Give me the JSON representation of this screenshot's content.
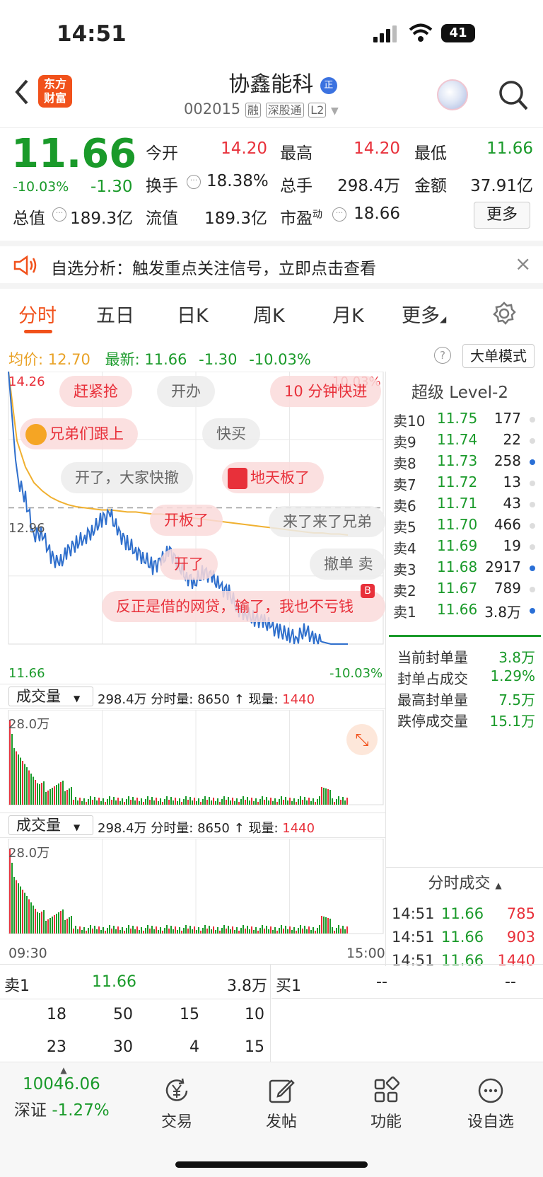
{
  "status": {
    "time": "14:51",
    "battery": "41"
  },
  "header": {
    "logo": [
      "东方",
      "财富"
    ],
    "stock_name": "协鑫能科",
    "badge": "正",
    "code": "002015",
    "tags": [
      "融",
      "深股通",
      "L2"
    ]
  },
  "quote": {
    "price": "11.66",
    "change_pct": "-10.03%",
    "change": "-1.30",
    "open_label": "今开",
    "open": "14.20",
    "high_label": "最高",
    "high": "14.20",
    "low_label": "最低",
    "low": "11.66",
    "turnover_label": "换手",
    "turnover": "18.38%",
    "volume_label": "总手",
    "volume": "298.4万",
    "amount_label": "金额",
    "amount": "37.91亿",
    "mktcap_label": "总值",
    "mktcap": "189.3亿",
    "float_label": "流值",
    "float": "189.3亿",
    "pe_label": "市盈",
    "pe_sup": "动",
    "pe": "18.66",
    "more_button": "更多"
  },
  "alert": {
    "text": "自选分析：触发重点关注信号，立即点击查看",
    "close": "×"
  },
  "tabs": [
    {
      "label": "分时",
      "active": true
    },
    {
      "label": "五日"
    },
    {
      "label": "日K"
    },
    {
      "label": "周K"
    },
    {
      "label": "月K"
    },
    {
      "label": "更多"
    }
  ],
  "chart_header": {
    "avg_label": "均价:",
    "avg": "12.70",
    "latest_label": "最新:",
    "latest": "11.66",
    "change": "-1.30",
    "change_pct": "-10.03%",
    "mode_button": "大单模式"
  },
  "chart_axis": {
    "top_price": "14.26",
    "top_pct": "10.03%",
    "mid_price": "12.96",
    "bottom_price": "11.66",
    "bottom_pct": "-10.03%"
  },
  "danmaku": [
    {
      "text": "赶紧抢",
      "style": "red"
    },
    {
      "text": "开办",
      "style": "gray"
    },
    {
      "text": "10 分钟快进",
      "style": "red"
    },
    {
      "text": "兄弟们跟上",
      "style": "red"
    },
    {
      "text": "快买",
      "style": "gray"
    },
    {
      "text": "开了，大家快撤",
      "style": "gray"
    },
    {
      "text": "地天板了",
      "style": "red"
    },
    {
      "text": "开板了",
      "style": "red"
    },
    {
      "text": "来了来了兄弟",
      "style": "gray"
    },
    {
      "text": "开了",
      "style": "red"
    },
    {
      "text": "撤单 卖",
      "style": "gray"
    },
    {
      "text": "反正是借的网贷，输了，我也不亏钱",
      "style": "red"
    }
  ],
  "volume_panels": [
    {
      "label": "成交量",
      "total": "298.4万",
      "minute_label": "分时量:",
      "minute": "8650",
      "now_label": "现量:",
      "now": "1440",
      "axis_max": "28.0万"
    },
    {
      "label": "成交量",
      "total": "298.4万",
      "minute_label": "分时量:",
      "minute": "8650",
      "now_label": "现量:",
      "now": "1440",
      "axis_max": "28.0万"
    }
  ],
  "time_axis": {
    "start": "09:30",
    "end": "15:00"
  },
  "orderbook": {
    "title": "超级 Level-2",
    "asks": [
      {
        "label": "卖10",
        "price": "11.75",
        "vol": "177"
      },
      {
        "label": "卖9",
        "price": "11.74",
        "vol": "22"
      },
      {
        "label": "卖8",
        "price": "11.73",
        "vol": "258"
      },
      {
        "label": "卖7",
        "price": "11.72",
        "vol": "13"
      },
      {
        "label": "卖6",
        "price": "11.71",
        "vol": "43"
      },
      {
        "label": "卖5",
        "price": "11.70",
        "vol": "466"
      },
      {
        "label": "卖4",
        "price": "11.69",
        "vol": "19"
      },
      {
        "label": "卖3",
        "price": "11.68",
        "vol": "2917"
      },
      {
        "label": "卖2",
        "price": "11.67",
        "vol": "789"
      },
      {
        "label": "卖1",
        "price": "11.66",
        "vol": "3.8万"
      }
    ],
    "stats": [
      {
        "label": "当前封单量",
        "value": "3.8万"
      },
      {
        "label": "封单占成交",
        "value": "1.29%"
      },
      {
        "label": "最高封单量",
        "value": "7.5万"
      },
      {
        "label": "跌停成交量",
        "value": "15.1万"
      }
    ],
    "ticks_title": "分时成交",
    "ticks": [
      {
        "time": "14:51",
        "price": "11.66",
        "vol": "785"
      },
      {
        "time": "14:51",
        "price": "11.66",
        "vol": "903"
      },
      {
        "time": "14:51",
        "price": "11.66",
        "vol": "1440"
      }
    ]
  },
  "bottom_table": {
    "sell_label": "卖1",
    "sell_price": "11.66",
    "sell_vol": "3.8万",
    "buy_label": "买1",
    "buy_price": "--",
    "buy_vol": "--",
    "rows": [
      [
        "18",
        "50",
        "15",
        "10"
      ],
      [
        "23",
        "30",
        "4",
        "15"
      ]
    ]
  },
  "footer": {
    "index_value": "10046.06",
    "index_name": "深证",
    "index_change": "-1.27%",
    "buttons": [
      {
        "label": "交易",
        "icon": "yen-cycle-icon"
      },
      {
        "label": "发帖",
        "icon": "edit-icon"
      },
      {
        "label": "功能",
        "icon": "grid-icon"
      },
      {
        "label": "设自选",
        "icon": "dots-circle-icon"
      }
    ]
  },
  "chart_data": {
    "type": "line",
    "title": "",
    "xlabel": "",
    "ylabel": "",
    "x_range": [
      "09:30",
      "15:00"
    ],
    "ylim": [
      11.66,
      14.26
    ],
    "series": [
      {
        "name": "最新",
        "color": "#2f6fcc",
        "values": [
          14.26,
          13.25,
          13.05,
          12.7,
          12.72,
          12.5,
          12.42,
          12.55,
          12.62,
          12.68,
          12.75,
          12.85,
          12.9,
          12.72,
          12.62,
          12.55,
          12.48,
          12.4,
          12.45,
          12.55,
          12.42,
          12.3,
          12.25,
          12.35,
          12.3,
          12.2,
          12.15,
          12.0,
          11.95,
          11.9,
          11.88,
          11.82,
          11.78,
          11.75,
          11.72,
          11.8,
          11.7,
          11.68,
          11.66,
          11.66,
          11.66
        ]
      },
      {
        "name": "均价",
        "color": "#f0b030",
        "values": [
          14.26,
          13.6,
          13.35,
          13.2,
          13.12,
          13.06,
          13.02,
          12.99,
          12.97,
          12.96,
          12.95,
          12.94,
          12.94,
          12.93,
          12.92,
          12.92,
          12.91,
          12.9,
          12.9,
          12.89,
          12.88,
          12.87,
          12.86,
          12.85,
          12.84,
          12.83,
          12.82,
          12.81,
          12.8,
          12.79,
          12.78,
          12.77,
          12.76,
          12.75,
          12.74,
          12.73,
          12.72,
          12.72,
          12.71,
          12.71,
          12.7
        ]
      }
    ],
    "baseline": 12.96,
    "grid": true
  }
}
